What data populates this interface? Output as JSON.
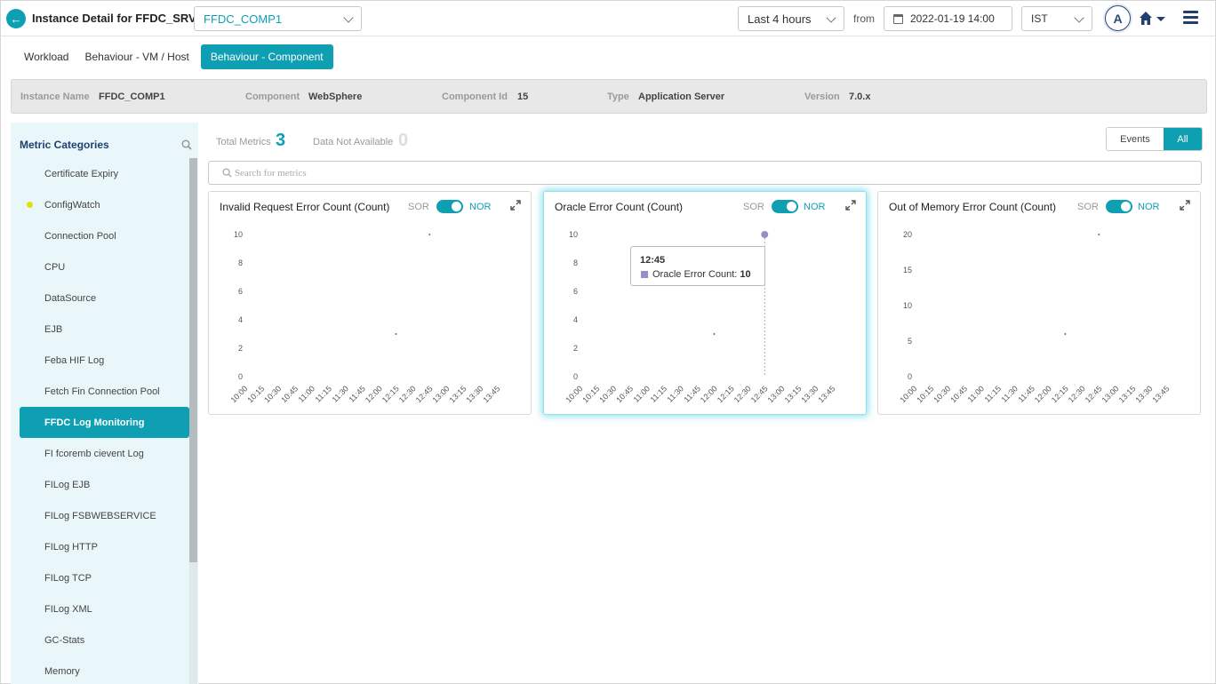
{
  "header": {
    "title": "Instance Detail for FFDC_SRV",
    "component_select": "FFDC_COMP1",
    "time_range": "Last 4 hours",
    "from_label": "from",
    "from_date": "2022-01-19 14:00",
    "timezone": "IST",
    "avatar_initial": "A"
  },
  "tabs": [
    {
      "label": "Workload"
    },
    {
      "label": "Behaviour - VM / Host"
    },
    {
      "label": "Behaviour - Component"
    }
  ],
  "info": {
    "instance_name_label": "Instance Name",
    "instance_name": "FFDC_COMP1",
    "component_label": "Component",
    "component": "WebSphere",
    "component_id_label": "Component Id",
    "component_id": "15",
    "type_label": "Type",
    "type": "Application Server",
    "version_label": "Version",
    "version": "7.0.x"
  },
  "sidebar": {
    "title": "Metric Categories",
    "items": [
      {
        "label": "Certificate Expiry"
      },
      {
        "label": "ConfigWatch"
      },
      {
        "label": "Connection Pool"
      },
      {
        "label": "CPU"
      },
      {
        "label": "DataSource"
      },
      {
        "label": "EJB"
      },
      {
        "label": "Feba HIF Log"
      },
      {
        "label": "Fetch Fin Connection Pool"
      },
      {
        "label": "FFDC Log Monitoring"
      },
      {
        "label": "FI fcoremb cievent Log"
      },
      {
        "label": "FILog EJB"
      },
      {
        "label": "FILog FSBWEBSERVICE"
      },
      {
        "label": "FILog HTTP"
      },
      {
        "label": "FILog TCP"
      },
      {
        "label": "FILog XML"
      },
      {
        "label": "GC-Stats"
      },
      {
        "label": "Memory"
      }
    ],
    "active_item": "FFDC Log Monitoring",
    "flagged_item": "ConfigWatch"
  },
  "summary": {
    "total_label": "Total Metrics",
    "total_value": "3",
    "na_label": "Data Not Available",
    "na_value": "0"
  },
  "filter": {
    "events_label": "Events",
    "all_label": "All"
  },
  "search": {
    "placeholder": "Search for metrics"
  },
  "toggle_labels": {
    "sor": "SOR",
    "nor": "NOR"
  },
  "tooltip": {
    "time": "12:45",
    "series": "Oracle Error Count: ",
    "value": "10"
  },
  "colors": {
    "accent": "#0f9fb3",
    "series": "#9b8bc6",
    "sidebar_bg": "#eaf7fa"
  },
  "chart_data": [
    {
      "type": "line",
      "title": "Invalid Request Error Count (Count)",
      "x": [
        "10:00",
        "10:15",
        "10:30",
        "10:45",
        "11:00",
        "11:15",
        "11:30",
        "11:45",
        "12:00",
        "12:15",
        "12:30",
        "12:45",
        "13:00",
        "13:15",
        "13:30",
        "13:45"
      ],
      "yticks": [
        "0",
        "2",
        "4",
        "6",
        "8",
        "10"
      ],
      "ylim": [
        0,
        10
      ],
      "series": [
        {
          "values": [
            null,
            null,
            null,
            null,
            null,
            null,
            null,
            null,
            null,
            3,
            null,
            10,
            null,
            null,
            null,
            null
          ]
        }
      ]
    },
    {
      "type": "line",
      "title": "Oracle Error Count (Count)",
      "x": [
        "10:00",
        "10:15",
        "10:30",
        "10:45",
        "11:00",
        "11:15",
        "11:30",
        "11:45",
        "12:00",
        "12:15",
        "12:30",
        "12:45",
        "13:00",
        "13:15",
        "13:30",
        "13:45"
      ],
      "yticks": [
        "0",
        "2",
        "4",
        "6",
        "8",
        "10"
      ],
      "ylim": [
        0,
        10
      ],
      "series": [
        {
          "values": [
            null,
            null,
            null,
            null,
            null,
            null,
            null,
            null,
            3,
            null,
            null,
            10,
            null,
            null,
            null,
            null
          ]
        }
      ]
    },
    {
      "type": "line",
      "title": "Out of Memory Error Count (Count)",
      "x": [
        "10:00",
        "10:15",
        "10:30",
        "10:45",
        "11:00",
        "11:15",
        "11:30",
        "11:45",
        "12:00",
        "12:15",
        "12:30",
        "12:45",
        "13:00",
        "13:15",
        "13:30",
        "13:45"
      ],
      "yticks": [
        "0",
        "5",
        "10",
        "15",
        "20"
      ],
      "ylim": [
        0,
        20
      ],
      "series": [
        {
          "values": [
            null,
            null,
            null,
            null,
            null,
            null,
            null,
            null,
            null,
            6,
            null,
            20,
            null,
            null,
            null,
            null
          ]
        }
      ]
    }
  ]
}
